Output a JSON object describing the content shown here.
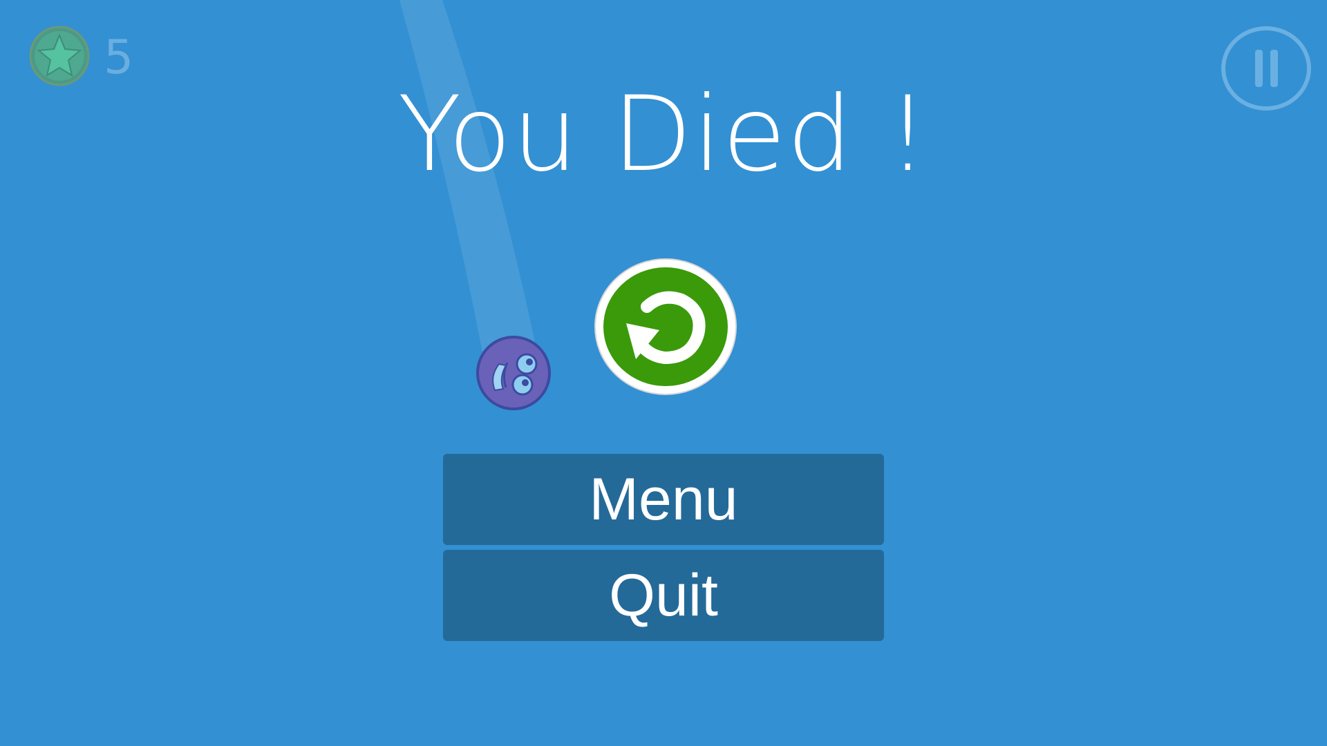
{
  "hud": {
    "star_icon": "star-coin-icon",
    "star_count": "5",
    "pause_icon": "pause-icon"
  },
  "overlay": {
    "title": "You Died !",
    "restart_icon": "restart-icon",
    "menu_label": "Menu",
    "quit_label": "Quit"
  },
  "colors": {
    "background": "#3390d3",
    "button_background": "#246a99",
    "restart_green": "#3a9a0a",
    "text": "#ffffff"
  }
}
